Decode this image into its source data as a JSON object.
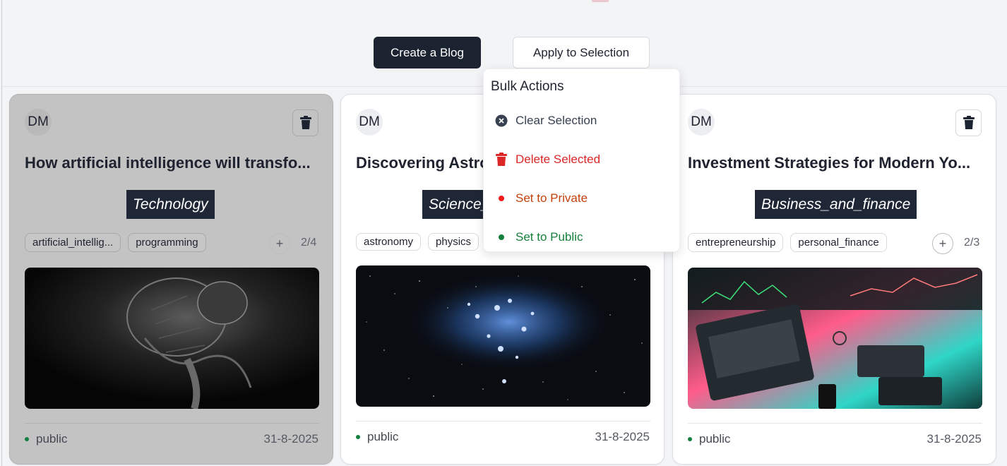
{
  "header": {
    "create_label": "Create a Blog",
    "apply_label": "Apply to Selection"
  },
  "bulk_menu": {
    "title": "Bulk Actions",
    "items": [
      {
        "label": "Clear Selection",
        "color": "#374151",
        "icon": "x-circle-icon"
      },
      {
        "label": "Delete Selected",
        "color": "#dc2626",
        "icon": "trash-icon"
      },
      {
        "label": "Set to Private",
        "color": "#c2410c",
        "icon": "dot-icon"
      },
      {
        "label": "Set to Public",
        "color": "#15803d",
        "icon": "dot-icon"
      }
    ]
  },
  "cards": [
    {
      "avatar": "DM",
      "title": "How artificial intelligence will transfo...",
      "category": "Technology",
      "tags": [
        "artificial_intellig...",
        "programming"
      ],
      "tag_count": "2/4",
      "status": "public",
      "date": "31-8-2025",
      "selected": true,
      "image": "robot-image"
    },
    {
      "avatar": "DM",
      "title": "Discovering Astro",
      "category": "Science_",
      "tags": [
        "astronomy",
        "physics"
      ],
      "tag_count": "",
      "status": "public",
      "date": "31-8-2025",
      "selected": false,
      "image": "star-cluster-image"
    },
    {
      "avatar": "DM",
      "title": "Investment Strategies for Modern Yo...",
      "category": "Business_and_finance",
      "tags": [
        "entrepreneurship",
        "personal_finance"
      ],
      "tag_count": "2/3",
      "status": "public",
      "date": "31-8-2025",
      "selected": false,
      "image": "trading-desk-image"
    }
  ],
  "colors": {
    "primary_dark": "#1b2230",
    "public_green": "#15803d",
    "danger_red": "#dc2626",
    "private_orange": "#c2410c"
  }
}
